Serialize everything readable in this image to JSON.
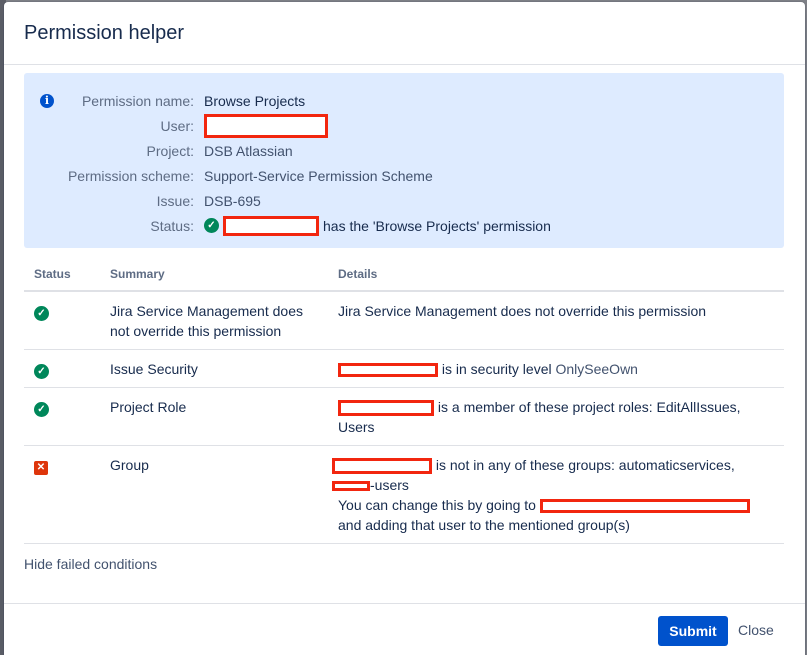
{
  "dialog": {
    "title": "Permission helper"
  },
  "info": {
    "icon": "info-icon",
    "rows": [
      {
        "label": "Permission name:",
        "value": "Browse Projects"
      },
      {
        "label": "User:",
        "value": ""
      },
      {
        "label": "Project:",
        "value": "DSB Atlassian"
      },
      {
        "label": "Permission scheme:",
        "value": "Support-Service Permission Scheme"
      },
      {
        "label": "Issue:",
        "value": "DSB-695"
      },
      {
        "label": "Status:",
        "value": "has the 'Browse Projects' permission"
      }
    ]
  },
  "table": {
    "headers": [
      "Status",
      "Summary",
      "Details"
    ],
    "rows": [
      {
        "status": "pass",
        "summary": "Jira Service Management does not override this permission",
        "details": "Jira Service Management does not override this permission"
      },
      {
        "status": "pass",
        "summary": "Issue Security",
        "details": "is in security level",
        "details_link": "OnlySeeOwn"
      },
      {
        "status": "pass",
        "summary": "Project Role",
        "details": "is a member of these project roles: EditAllIssues, Users"
      },
      {
        "status": "fail",
        "summary": "Group",
        "details": "is not in any of these groups: automaticservices,",
        "details_line2": "-users",
        "details_line3": "You can change this by going to",
        "details_line4": "and adding that user to the mentioned group(s)"
      }
    ]
  },
  "hide_failed_label": "Hide failed conditions",
  "footer": {
    "submit_label": "Submit",
    "close_label": "Close"
  },
  "colors": {
    "accent": "#0052cc",
    "success": "#00875a",
    "error": "#de350b",
    "info_panel": "#deebff",
    "redaction": "#f2260f"
  }
}
